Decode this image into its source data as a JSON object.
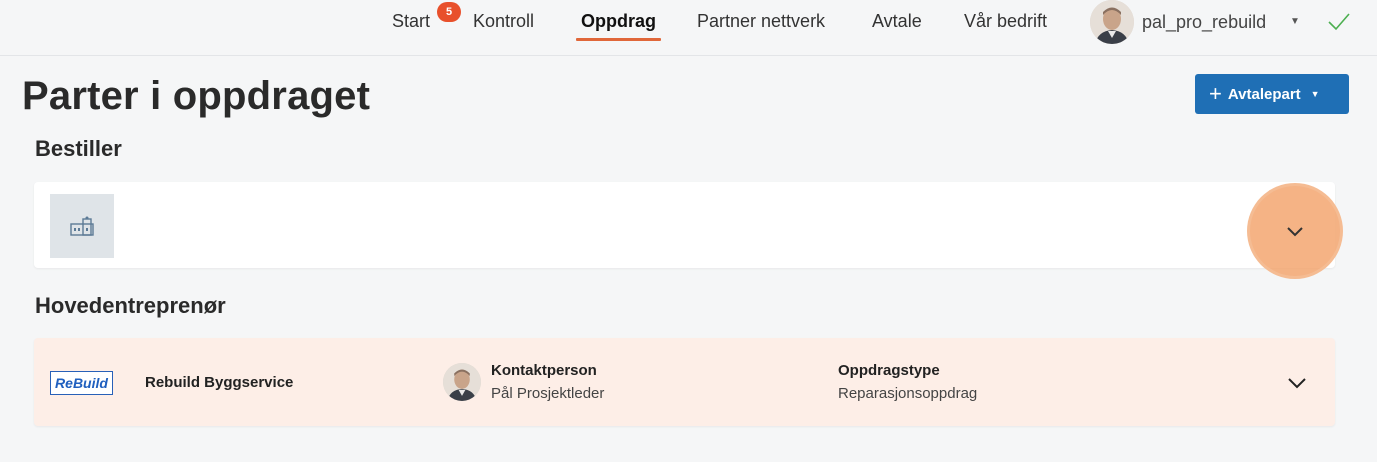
{
  "nav": {
    "items": [
      {
        "label": "Start"
      },
      {
        "label": "Kontroll"
      },
      {
        "label": "Oppdrag"
      },
      {
        "label": "Partner nettverk"
      },
      {
        "label": "Avtale"
      },
      {
        "label": "Vår bedrift"
      }
    ],
    "active": "Oppdrag",
    "start_badge": "5",
    "user_name": "pal_pro_rebuild"
  },
  "page": {
    "title": "Parter i oppdraget",
    "add_button_label": "Avtalepart"
  },
  "sections": {
    "bestiller": {
      "heading": "Bestiller"
    },
    "hovedentreprenor": {
      "heading": "Hovedentreprenør",
      "logo_text": "ReBuild",
      "company_name": "Rebuild Byggservice",
      "contact_label": "Kontaktperson",
      "contact_value": "Pål Prosjektleder",
      "type_label": "Oppdragstype",
      "type_value": "Reparasjonsoppdrag"
    }
  },
  "colors": {
    "accent": "#e0673a",
    "primary_button": "#1f6fb5",
    "card_highlight": "#fdeee7",
    "badge": "#e8502b"
  }
}
